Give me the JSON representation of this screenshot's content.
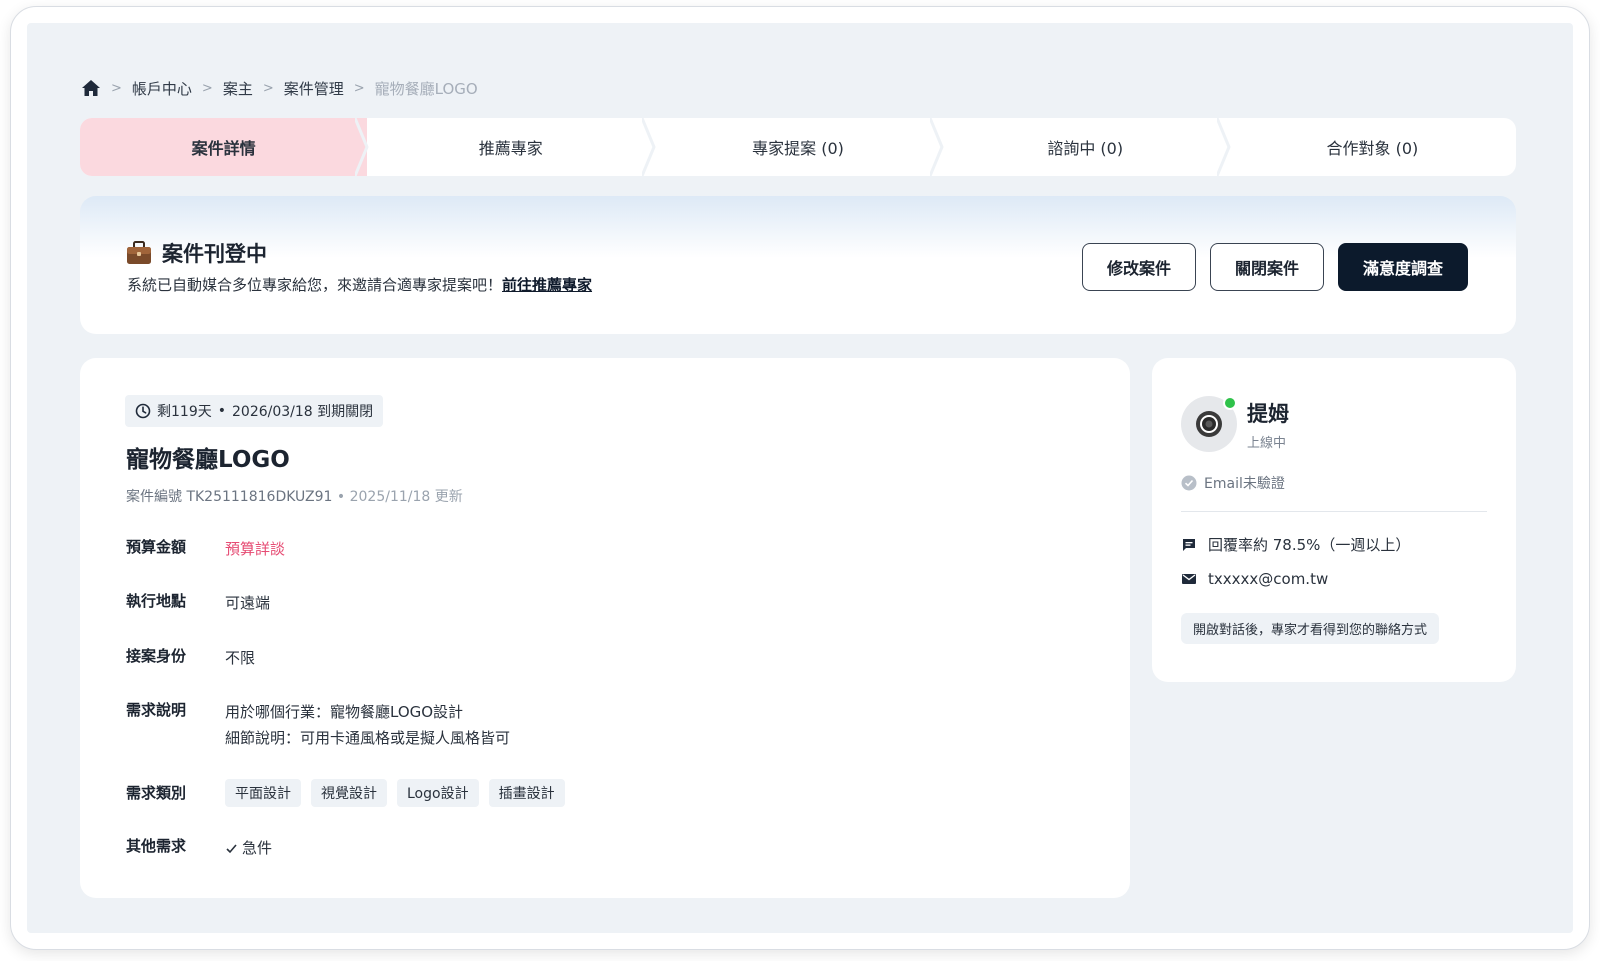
{
  "breadcrumb": {
    "items": [
      "帳戶中心",
      "案主",
      "案件管理"
    ],
    "current": "寵物餐廳LOGO",
    "separator": ">"
  },
  "steps": [
    {
      "label": "案件詳情",
      "active": true
    },
    {
      "label": "推薦專家",
      "active": false
    },
    {
      "label": "專家提案 (0)",
      "active": false
    },
    {
      "label": "諮詢中 (0)",
      "active": false
    },
    {
      "label": "合作對象 (0)",
      "active": false
    }
  ],
  "status": {
    "title": "案件刊登中",
    "description": "系統已自動媒合多位專家給您，來邀請合適專家提案吧！",
    "link_label": "前往推薦專家",
    "buttons": {
      "edit": "修改案件",
      "close": "關閉案件",
      "survey": "滿意度調查"
    }
  },
  "case": {
    "deadline_remaining": "剩119天",
    "deadline_date": "2026/03/18 到期關閉",
    "title": "寵物餐廳LOGO",
    "number_label": "案件編號 TK25111816DKUZ91",
    "updated": "2025/11/18 更新",
    "fields": {
      "budget": {
        "label": "預算金額",
        "value": "預算詳談"
      },
      "location": {
        "label": "執行地點",
        "value": "可遠端"
      },
      "identity": {
        "label": "接案身份",
        "value": "不限"
      },
      "description": {
        "label": "需求說明",
        "line1": "用於哪個行業：寵物餐廳LOGO設計",
        "line2": "細節說明：可用卡通風格或是擬人風格皆可"
      },
      "category": {
        "label": "需求類別",
        "tags": [
          "平面設計",
          "視覺設計",
          "Logo設計",
          "插畫設計"
        ]
      },
      "other": {
        "label": "其他需求",
        "value": "急件"
      }
    }
  },
  "profile": {
    "name": "提姆",
    "status": "上線中",
    "email_verify": "Email未驗證",
    "reply_rate": "回覆率約 78.5%（一週以上）",
    "email": "txxxxx@com.tw",
    "contact_note": "開啟對話後，專家才看得到您的聯絡方式"
  },
  "colors": {
    "active_step": "#fbd9df",
    "budget_highlight": "#e64b73",
    "primary_dark": "#0c1a2c",
    "online": "#2fc24a"
  }
}
